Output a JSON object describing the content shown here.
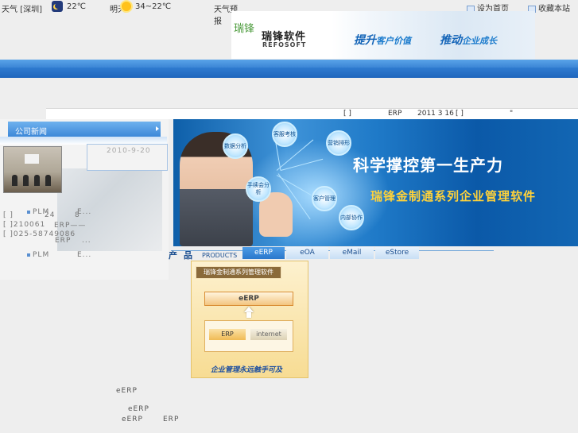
{
  "weather": {
    "label1": "天气 [深圳]",
    "temp1": "22℃",
    "label2": "明天",
    "temp2": "34~22℃",
    "label3": "天气预报"
  },
  "toplinks": {
    "homepage": "设为首页",
    "favorite": "收藏本站"
  },
  "brand": {
    "art": "瑞锋",
    "name_cn": "瑞锋软件",
    "name_en": "REFOSOFT",
    "slogan1_main": "提升",
    "slogan1_sub": "客户价值",
    "slogan2_main": "推动",
    "slogan2_sub": "企业成长"
  },
  "strip": {
    "bracket1": "[ ]",
    "erp": "ERP",
    "date": "2011 3 16",
    "bracket2": "[ ]",
    "quote": "\""
  },
  "news": {
    "tab": "公司新闻",
    "date": "2010-9-20",
    "line1a": "PLM",
    "line1b": "E...",
    "line2a": "[ ]",
    "line2b": "24",
    "line2c": "8",
    "line3a": "[ ]210061",
    "line3b": "ERP——",
    "line4a": "[ ]025-58749086",
    "line4b": "ERP",
    "line4c": "...",
    "line5a": "PLM",
    "line5b": "E..."
  },
  "hero": {
    "title": "科学撑控第一生产力",
    "subtitle": "瑞锋金制通系列企业管理软件",
    "bubbles": [
      "数据分析",
      "客服考核",
      "营销排形",
      "手续会分析",
      "客户管理",
      "内部协作"
    ]
  },
  "products": {
    "cn": "产品",
    "en": "PRODUCTS",
    "tabs": [
      "eERP",
      "eOA",
      "eMail",
      "eStore"
    ]
  },
  "diagram": {
    "title": "瑞锋金制通系列管理软件",
    "eerp": "eERP",
    "erp": "ERP",
    "internet": "internet",
    "footer": "企业管理永远触手可及"
  },
  "lower": {
    "t1": "eERP",
    "t2": "eERP",
    "t3a": "eERP",
    "t3b": "ERP"
  }
}
